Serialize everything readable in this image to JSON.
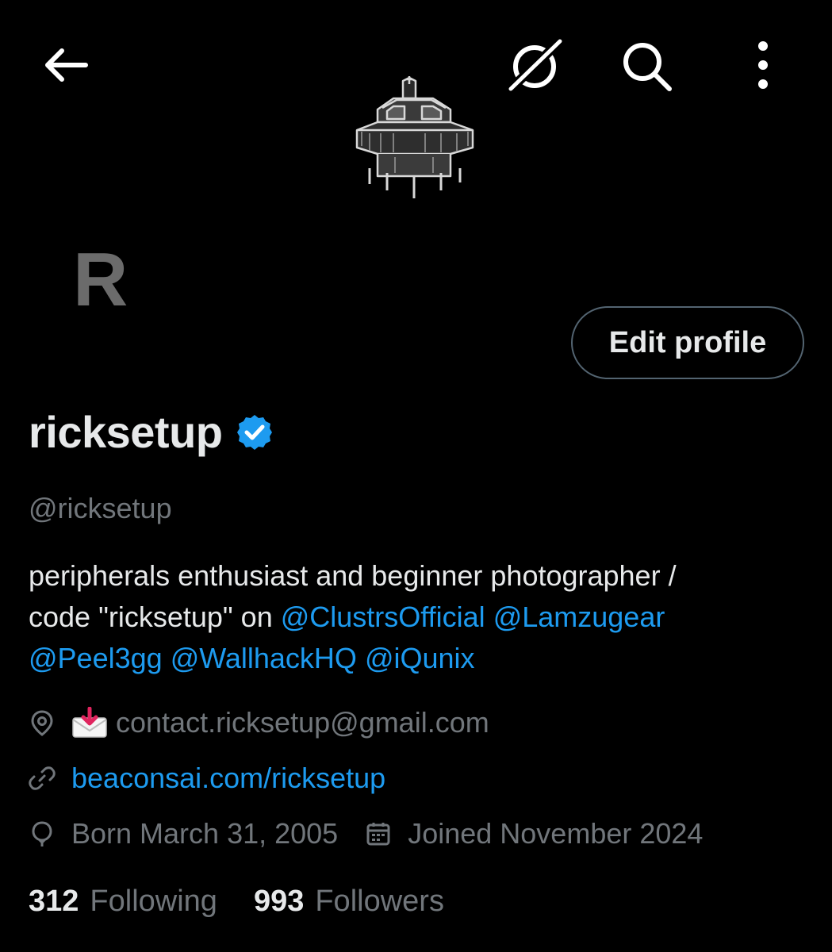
{
  "icons": {
    "back": "arrow-left-icon",
    "grok": "grok-icon",
    "search": "search-icon",
    "more": "more-vertical-icon",
    "verified": "verified-badge-icon",
    "location": "location-pin-icon",
    "envelope": "incoming-envelope-emoji",
    "link": "link-icon",
    "birthday": "balloon-icon",
    "calendar": "calendar-icon"
  },
  "colors": {
    "background": "#000000",
    "text": "#e7e9ea",
    "secondary": "#71767b",
    "accent": "#1d9bf0",
    "border": "#536471"
  },
  "avatar": {
    "letter": "R"
  },
  "profile": {
    "edit_label": "Edit profile",
    "display_name": "ricksetup",
    "handle": "@ricksetup",
    "bio_line1": "peripherals enthusiast and beginner photographer /",
    "bio_code_prefix": "code \"ricksetup\" on ",
    "mentions": [
      "@ClustrsOfficial",
      "@Lamzugear",
      "@Peel3gg",
      "@WallhackHQ",
      "@iQunix"
    ],
    "location": "contact.ricksetup@gmail.com",
    "website": "beaconsai.com/ricksetup",
    "born": "Born March 31, 2005",
    "joined": "Joined November 2024"
  },
  "stats": {
    "following_count": "312",
    "following_label": "Following",
    "followers_count": "993",
    "followers_label": "Followers"
  }
}
